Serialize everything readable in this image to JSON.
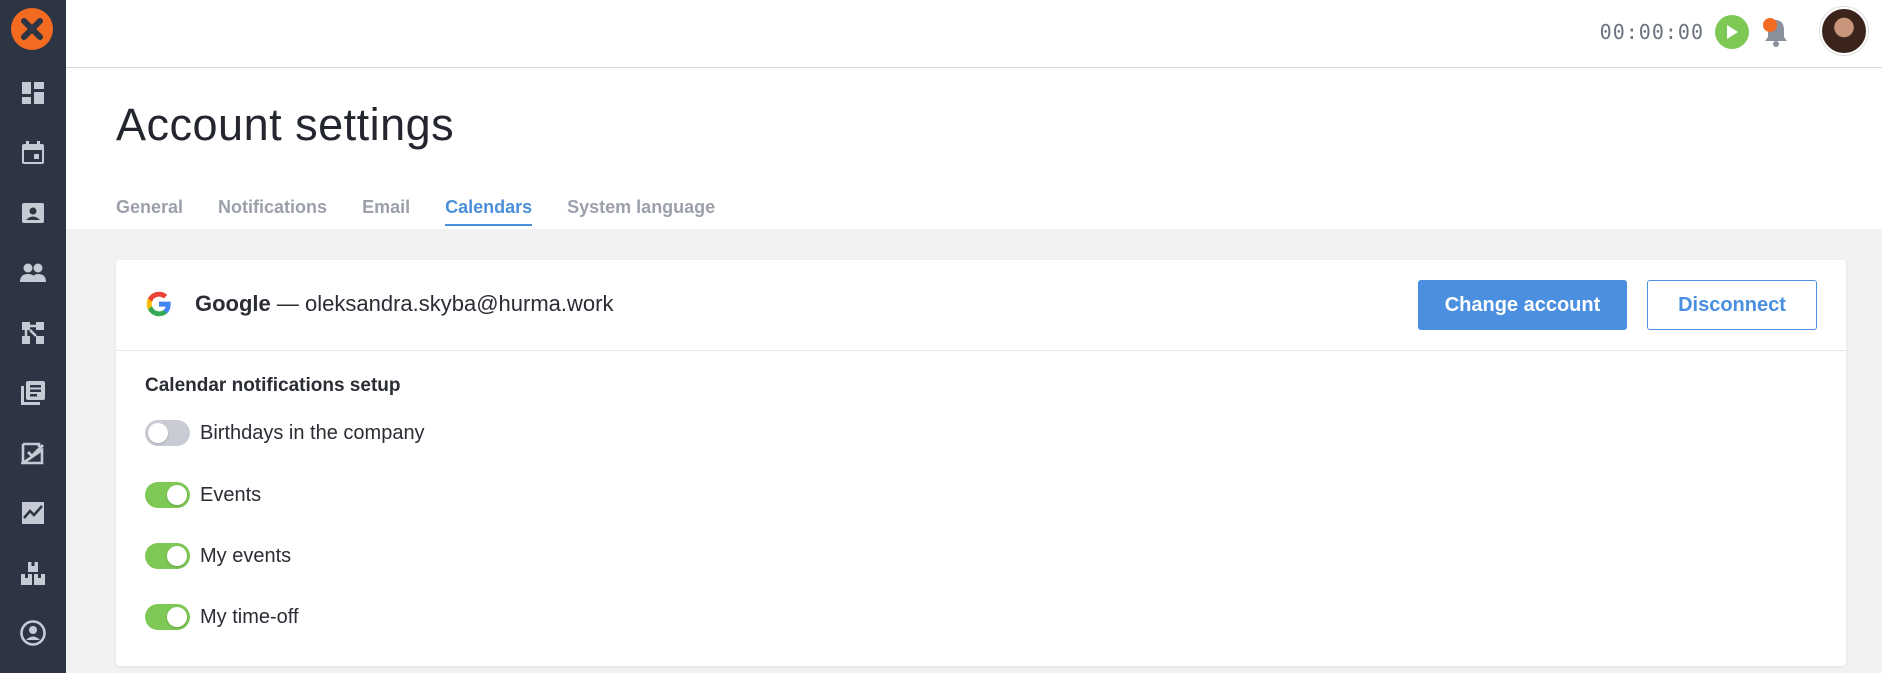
{
  "app": {
    "accent": "#4a8fe0",
    "success": "#7ec856",
    "brand": "#f26b21"
  },
  "sidebar": {
    "items": [
      {
        "icon": "dashboard-icon"
      },
      {
        "icon": "calendar-icon"
      },
      {
        "icon": "contact-card-icon"
      },
      {
        "icon": "people-icon"
      },
      {
        "icon": "org-structure-icon"
      },
      {
        "icon": "library-icon"
      },
      {
        "icon": "tasks-checkbox-icon"
      },
      {
        "icon": "analytics-chart-icon"
      },
      {
        "icon": "assets-boxes-icon"
      },
      {
        "icon": "profile-icon"
      }
    ]
  },
  "topbar": {
    "timer": "00:00:00"
  },
  "page": {
    "title": "Account settings",
    "tabs": [
      {
        "label": "General",
        "active": false
      },
      {
        "label": "Notifications",
        "active": false
      },
      {
        "label": "Email",
        "active": false
      },
      {
        "label": "Calendars",
        "active": true
      },
      {
        "label": "System language",
        "active": false
      }
    ]
  },
  "account": {
    "provider": "Google",
    "separator": " — ",
    "email": "oleksandra.skyba@hurma.work",
    "change_label": "Change account",
    "disconnect_label": "Disconnect"
  },
  "notifications": {
    "title": "Calendar notifications setup",
    "items": [
      {
        "label": "Birthdays in the company",
        "enabled": false
      },
      {
        "label": "Events",
        "enabled": true
      },
      {
        "label": "My events",
        "enabled": true
      },
      {
        "label": "My time-off",
        "enabled": true
      }
    ]
  }
}
